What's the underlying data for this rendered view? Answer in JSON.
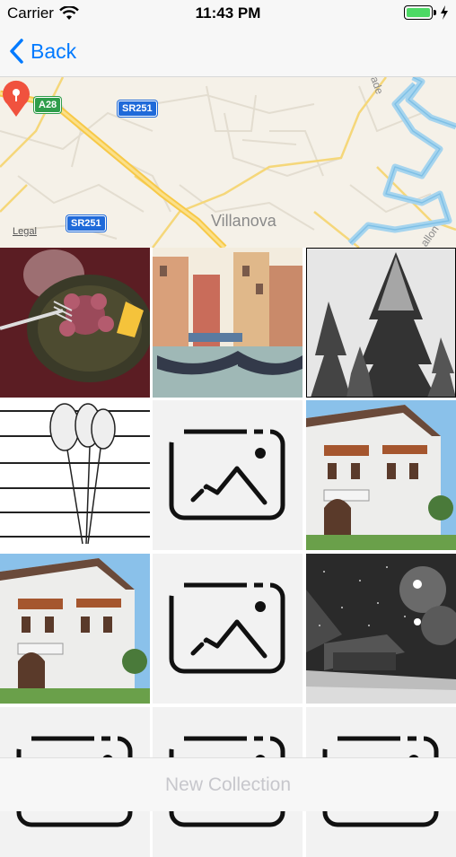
{
  "status_bar": {
    "carrier": "Carrier",
    "time": "11:43 PM"
  },
  "nav": {
    "back_label": "Back"
  },
  "map": {
    "place_label": "Villanova",
    "legal": "Legal",
    "shields": [
      "A28",
      "SR251",
      "SR251"
    ],
    "road_fragments": [
      "ade",
      "allon"
    ]
  },
  "photos": [
    {
      "kind": "photo",
      "subject": "octopus-dish-photo"
    },
    {
      "kind": "photo",
      "subject": "canal-watercolor-photo"
    },
    {
      "kind": "photo",
      "subject": "snowy-pines-photo"
    },
    {
      "kind": "photo",
      "subject": "spoons-sketch-photo"
    },
    {
      "kind": "placeholder",
      "subject": "image-placeholder-icon"
    },
    {
      "kind": "photo",
      "subject": "alpine-hotel-photo"
    },
    {
      "kind": "photo",
      "subject": "alpine-hotel-photo"
    },
    {
      "kind": "placeholder",
      "subject": "image-placeholder-icon"
    },
    {
      "kind": "photo",
      "subject": "snowy-night-street-photo"
    },
    {
      "kind": "placeholder",
      "subject": "image-placeholder-icon"
    },
    {
      "kind": "placeholder",
      "subject": "image-placeholder-icon"
    },
    {
      "kind": "placeholder",
      "subject": "image-placeholder-icon"
    }
  ],
  "bottom_bar": {
    "new_collection_label": "New Collection"
  },
  "colors": {
    "tint": "#007aff",
    "disabled": "#c7c7cc",
    "battery": "#4cd964",
    "pin": "#f0523e"
  }
}
